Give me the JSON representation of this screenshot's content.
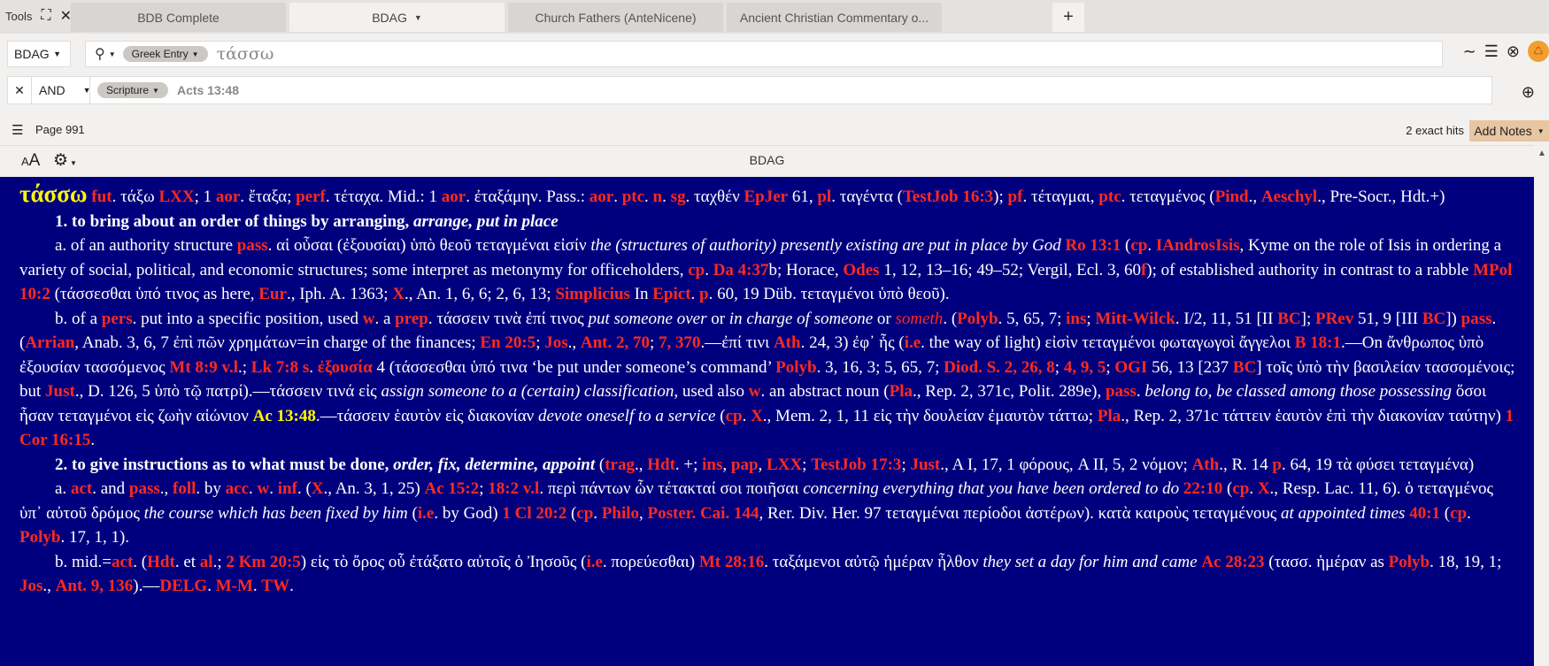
{
  "tabbar": {
    "tools_label": "Tools",
    "tabs": [
      {
        "label": "BDB Complete"
      },
      {
        "label": "BDAG"
      },
      {
        "label": "Church Fathers (AnteNicene)"
      },
      {
        "label": "Ancient Christian Commentary o..."
      }
    ],
    "new_tab": "+"
  },
  "search": {
    "resource": "BDAG",
    "mode_pill": "Greek Entry",
    "query": "τάσσω",
    "operator": "AND",
    "filter_pill": "Scripture",
    "filter_value": "Acts 13:48"
  },
  "status": {
    "page": "Page 991",
    "hits": "2 exact hits",
    "add_notes": "Add Notes"
  },
  "panel": {
    "title": "BDAG",
    "font_icon": "AA"
  },
  "icons": {
    "fullscreen": "fullscreen-icon",
    "close": "close-icon",
    "search": "search-icon",
    "tilde": "tilde-icon",
    "list": "list-icon",
    "gear": "gear-icon",
    "recycle": "recycle-icon"
  },
  "colors": {
    "content_bg": "#00007e",
    "headword": "#fff800",
    "link": "#ff2a1e",
    "add_notes": "#e8c6a2"
  },
  "entry": {
    "headword": "τάσσω",
    "l1": [
      {
        "t": "fut",
        "c": "r"
      },
      {
        "t": ". τάξω "
      },
      {
        "t": "LXX",
        "c": "r"
      },
      {
        "t": "; 1 "
      },
      {
        "t": "aor",
        "c": "r"
      },
      {
        "t": ". ἔταξα; "
      },
      {
        "t": "perf",
        "c": "r"
      },
      {
        "t": ". τέταχα. Mid.: 1 "
      },
      {
        "t": "aor",
        "c": "r"
      },
      {
        "t": ". ἐταξάμην. Pass.: "
      },
      {
        "t": "aor",
        "c": "r"
      },
      {
        "t": ". "
      },
      {
        "t": "ptc",
        "c": "r"
      },
      {
        "t": ". "
      },
      {
        "t": "n",
        "c": "r"
      },
      {
        "t": ". "
      },
      {
        "t": "sg",
        "c": "r"
      },
      {
        "t": ". ταχθέν "
      },
      {
        "t": "EpJer",
        "c": "r"
      },
      {
        "t": " 61, "
      },
      {
        "t": "pl",
        "c": "r"
      },
      {
        "t": ". ταγέντα ("
      },
      {
        "t": "TestJob 16:3",
        "c": "r"
      },
      {
        "t": "); "
      },
      {
        "t": "pf",
        "c": "r"
      },
      {
        "t": ". τέταγμαι, "
      },
      {
        "t": "ptc",
        "c": "r"
      },
      {
        "t": ". τεταγμένος ("
      },
      {
        "t": "Pind",
        "c": "r"
      },
      {
        "t": "., "
      },
      {
        "t": "Aeschyl",
        "c": "r"
      },
      {
        "t": "., Pre-Socr., Hdt.+)"
      }
    ],
    "sense1": [
      {
        "t": "1. to bring about an order of things by arranging, ",
        "c": "b"
      },
      {
        "t": "arrange, put in place",
        "c": "bi"
      }
    ],
    "sense1a": [
      {
        "t": "a. of an authority structure "
      },
      {
        "t": "pass",
        "c": "r"
      },
      {
        "t": ". αἱ οὖσαι (ἐξουσίαι) ὑπὸ θεοῦ τεταγμέναι εἰσίν "
      },
      {
        "t": "the (structures of authority) presently existing are put in place by God",
        "c": "i"
      },
      {
        "t": " "
      },
      {
        "t": "Ro 13:1",
        "c": "r"
      },
      {
        "t": " ("
      },
      {
        "t": "cp",
        "c": "r"
      },
      {
        "t": ". "
      },
      {
        "t": "IAndrosIsis",
        "c": "r"
      },
      {
        "t": ", Kyme on the role of Isis in ordering a variety of social, political, and economic structures; some interpret as metonymy for officeholders, "
      },
      {
        "t": "cp",
        "c": "r"
      },
      {
        "t": ". "
      },
      {
        "t": "Da 4:37",
        "c": "r"
      },
      {
        "t": "b; Horace, "
      },
      {
        "t": "Odes",
        "c": "r"
      },
      {
        "t": " 1, 12, 13–16; 49–52; Vergil, Ecl. 3, 60"
      },
      {
        "t": "f",
        "c": "r"
      },
      {
        "t": "); of established authority in contrast to a rabble "
      },
      {
        "t": "MPol 10:2",
        "c": "r"
      },
      {
        "t": " (τάσσεσθαι ὑπό τινος as here, "
      },
      {
        "t": "Eur",
        "c": "r"
      },
      {
        "t": "., Iph. A. 1363; "
      },
      {
        "t": "X",
        "c": "r"
      },
      {
        "t": "., An. 1, 6, 6; 2, 6, 13; "
      },
      {
        "t": "Simplicius",
        "c": "r"
      },
      {
        "t": " In "
      },
      {
        "t": "Epict",
        "c": "r"
      },
      {
        "t": ". "
      },
      {
        "t": "p",
        "c": "r"
      },
      {
        "t": ". 60, 19 Düb. τεταγμένοι ὑπὸ θεοῦ)."
      }
    ],
    "sense1b": [
      {
        "t": "b. of a "
      },
      {
        "t": "pers",
        "c": "r"
      },
      {
        "t": ". put into a specific position, used "
      },
      {
        "t": "w",
        "c": "r"
      },
      {
        "t": ". a "
      },
      {
        "t": "prep",
        "c": "r"
      },
      {
        "t": ". τάσσειν τινὰ ἐπί τινος "
      },
      {
        "t": "put someone over",
        "c": "i"
      },
      {
        "t": " or "
      },
      {
        "t": "in charge of someone",
        "c": "i"
      },
      {
        "t": " or "
      },
      {
        "t": "someth",
        "c": "ri"
      },
      {
        "t": ". ("
      },
      {
        "t": "Polyb",
        "c": "r"
      },
      {
        "t": ". 5, 65, 7; "
      },
      {
        "t": "ins",
        "c": "r"
      },
      {
        "t": "; "
      },
      {
        "t": "Mitt-Wilck",
        "c": "r"
      },
      {
        "t": ". I/2, 11, 51 [II "
      },
      {
        "t": "BC",
        "c": "r"
      },
      {
        "t": "]; "
      },
      {
        "t": "PRev",
        "c": "r"
      },
      {
        "t": " 51, 9 [III "
      },
      {
        "t": "BC",
        "c": "r"
      },
      {
        "t": "]) "
      },
      {
        "t": "pass",
        "c": "r"
      },
      {
        "t": ". ("
      },
      {
        "t": "Arrian",
        "c": "r"
      },
      {
        "t": ", Anab. 3, 6, 7 ἐπὶ πῶν χρημάτων=in charge of the finances; "
      },
      {
        "t": "En 20:5",
        "c": "r"
      },
      {
        "t": "; "
      },
      {
        "t": "Jos",
        "c": "r"
      },
      {
        "t": "., "
      },
      {
        "t": "Ant. 2, 70",
        "c": "r"
      },
      {
        "t": "; "
      },
      {
        "t": "7, 370",
        "c": "r"
      },
      {
        "t": ".—ἐπί τινι "
      },
      {
        "t": "Ath",
        "c": "r"
      },
      {
        "t": ". 24, 3) ἐφ᾽ ἧς ("
      },
      {
        "t": "i.e",
        "c": "r"
      },
      {
        "t": ". the way of light) εἰσὶν τεταγμένοι φωταγωγοὶ ἄγγελοι "
      },
      {
        "t": "B 18:1",
        "c": "r"
      },
      {
        "t": ".—On ἄνθρωπος ὑπὸ ἐξουσίαν τασσόμενος "
      },
      {
        "t": "Mt 8:9 v.l",
        "c": "r"
      },
      {
        "t": ".; "
      },
      {
        "t": "Lk 7:8 s",
        "c": "r"
      },
      {
        "t": ". "
      },
      {
        "t": "ἐξουσία",
        "c": "r"
      },
      {
        "t": " 4 (τάσσεσθαι ὑπό τινα ‘be put under someone’s command’ "
      },
      {
        "t": "Polyb",
        "c": "r"
      },
      {
        "t": ". 3, 16, 3; 5, 65, 7; "
      },
      {
        "t": "Diod. S. 2, 26, 8",
        "c": "r"
      },
      {
        "t": "; "
      },
      {
        "t": "4, 9, 5",
        "c": "r"
      },
      {
        "t": "; "
      },
      {
        "t": "OGI",
        "c": "r"
      },
      {
        "t": " 56, 13 [237 "
      },
      {
        "t": "BC",
        "c": "r"
      },
      {
        "t": "] τοῖς ὑπὸ τὴν βασιλείαν τασσομένοις; but "
      },
      {
        "t": "Just",
        "c": "r"
      },
      {
        "t": "., D. 126, 5 ὑπὸ τῷ πατρί).—τάσσειν τινά εἰς "
      },
      {
        "t": "assign someone to a (certain) classification,",
        "c": "i"
      },
      {
        "t": " used also "
      },
      {
        "t": "w",
        "c": "r"
      },
      {
        "t": ". an abstract noun ("
      },
      {
        "t": "Pla",
        "c": "r"
      },
      {
        "t": "., Rep. 2, 371c, Polit. 289e), "
      },
      {
        "t": "pass",
        "c": "r"
      },
      {
        "t": ". "
      },
      {
        "t": "belong to, be classed among those possessing",
        "c": "i"
      },
      {
        "t": " ὅσοι ἦσαν τεταγμένοι εἰς ζωὴν αἰώνιον "
      },
      {
        "t": "Ac 13:48",
        "c": "y"
      },
      {
        "t": ".—τάσσειν ἑαυτὸν εἰς διακονίαν "
      },
      {
        "t": "devote oneself to a service",
        "c": "i"
      },
      {
        "t": " ("
      },
      {
        "t": "cp",
        "c": "r"
      },
      {
        "t": ". "
      },
      {
        "t": "X",
        "c": "r"
      },
      {
        "t": "., Mem. 2, 1, 11 εἰς τὴν δουλείαν ἐμαυτὸν τάττω; "
      },
      {
        "t": "Pla",
        "c": "r"
      },
      {
        "t": "., Rep. 2, 371c τάττειν ἑαυτὸν ἐπὶ τὴν διακονίαν ταύτην) "
      },
      {
        "t": "1 Cor 16:15",
        "c": "r"
      },
      {
        "t": "."
      }
    ],
    "sense2": [
      {
        "t": "2. to give instructions as to what must be done, ",
        "c": "b"
      },
      {
        "t": "order, fix, determine, appoint",
        "c": "bi"
      },
      {
        "t": " ("
      },
      {
        "t": "trag",
        "c": "r"
      },
      {
        "t": "., "
      },
      {
        "t": "Hdt",
        "c": "r"
      },
      {
        "t": ". +; "
      },
      {
        "t": "ins",
        "c": "r"
      },
      {
        "t": ", "
      },
      {
        "t": "pap",
        "c": "r"
      },
      {
        "t": ", "
      },
      {
        "t": "LXX",
        "c": "r"
      },
      {
        "t": "; "
      },
      {
        "t": "TestJob 17:3",
        "c": "r"
      },
      {
        "t": "; "
      },
      {
        "t": "Just",
        "c": "r"
      },
      {
        "t": "., A I, 17, 1 φόρους, A II, 5, 2 νόμον; "
      },
      {
        "t": "Ath",
        "c": "r"
      },
      {
        "t": "., R. 14 "
      },
      {
        "t": "p",
        "c": "r"
      },
      {
        "t": ". 64, 19 τὰ φύσει τεταγμένα)"
      }
    ],
    "sense2a": [
      {
        "t": "a. "
      },
      {
        "t": "act",
        "c": "r"
      },
      {
        "t": ". and "
      },
      {
        "t": "pass",
        "c": "r"
      },
      {
        "t": "., "
      },
      {
        "t": "foll",
        "c": "r"
      },
      {
        "t": ". by "
      },
      {
        "t": "acc",
        "c": "r"
      },
      {
        "t": ". "
      },
      {
        "t": "w",
        "c": "r"
      },
      {
        "t": ". "
      },
      {
        "t": "inf",
        "c": "r"
      },
      {
        "t": ". ("
      },
      {
        "t": "X",
        "c": "r"
      },
      {
        "t": "., An. 3, 1, 25) "
      },
      {
        "t": "Ac 15:2",
        "c": "r"
      },
      {
        "t": "; "
      },
      {
        "t": "18:2 v.l",
        "c": "r"
      },
      {
        "t": ". περὶ πάντων ὧν τέτακταί σοι ποιῆσαι "
      },
      {
        "t": "concerning everything that you have been ordered to do",
        "c": "i"
      },
      {
        "t": " "
      },
      {
        "t": "22:10",
        "c": "r"
      },
      {
        "t": " ("
      },
      {
        "t": "cp",
        "c": "r"
      },
      {
        "t": ". "
      },
      {
        "t": "X",
        "c": "r"
      },
      {
        "t": "., Resp. Lac. 11, 6). ὁ τεταγμένος ὑπ᾽ αὐτοῦ δρόμος "
      },
      {
        "t": "the course which has been fixed by him",
        "c": "i"
      },
      {
        "t": " ("
      },
      {
        "t": "i.e",
        "c": "r"
      },
      {
        "t": ". by God) "
      },
      {
        "t": "1 Cl 20:2",
        "c": "r"
      },
      {
        "t": " ("
      },
      {
        "t": "cp",
        "c": "r"
      },
      {
        "t": ". "
      },
      {
        "t": "Philo",
        "c": "r"
      },
      {
        "t": ", "
      },
      {
        "t": "Poster. Cai. 144",
        "c": "r"
      },
      {
        "t": ", Rer. Div. Her. 97 τεταγμέναι περίοδοι ἀστέρων). κατὰ καιροὺς τεταγμένους "
      },
      {
        "t": "at appointed times",
        "c": "i"
      },
      {
        "t": " "
      },
      {
        "t": "40:1",
        "c": "r"
      },
      {
        "t": " ("
      },
      {
        "t": "cp",
        "c": "r"
      },
      {
        "t": ". "
      },
      {
        "t": "Polyb",
        "c": "r"
      },
      {
        "t": ". 17, 1, 1)."
      }
    ],
    "sense2b": [
      {
        "t": "b. mid.="
      },
      {
        "t": "act",
        "c": "r"
      },
      {
        "t": ". ("
      },
      {
        "t": "Hdt",
        "c": "r"
      },
      {
        "t": ". et "
      },
      {
        "t": "al",
        "c": "r"
      },
      {
        "t": ".; "
      },
      {
        "t": "2 Km 20:5",
        "c": "r"
      },
      {
        "t": ") εἰς τὸ ὄρος οὗ ἐτάξατο αὐτοῖς ὁ Ἰησοῦς ("
      },
      {
        "t": "i.e",
        "c": "r"
      },
      {
        "t": ". πορεύεσθαι) "
      },
      {
        "t": "Mt 28:16",
        "c": "r"
      },
      {
        "t": ". ταξάμενοι αὐτῷ ἡμέραν ἦλθον "
      },
      {
        "t": "they set a day for him and came",
        "c": "i"
      },
      {
        "t": " "
      },
      {
        "t": "Ac 28:23",
        "c": "r"
      },
      {
        "t": " (τασσ. ἡμέραν as "
      },
      {
        "t": "Polyb",
        "c": "r"
      },
      {
        "t": ". 18, 19, 1; "
      },
      {
        "t": "Jos",
        "c": "r"
      },
      {
        "t": "., "
      },
      {
        "t": "Ant. 9, 136",
        "c": "r"
      },
      {
        "t": ").—"
      },
      {
        "t": "DELG",
        "c": "r"
      },
      {
        "t": ". "
      },
      {
        "t": "M-M",
        "c": "r"
      },
      {
        "t": ". "
      },
      {
        "t": "TW",
        "c": "r"
      },
      {
        "t": "."
      }
    ]
  }
}
